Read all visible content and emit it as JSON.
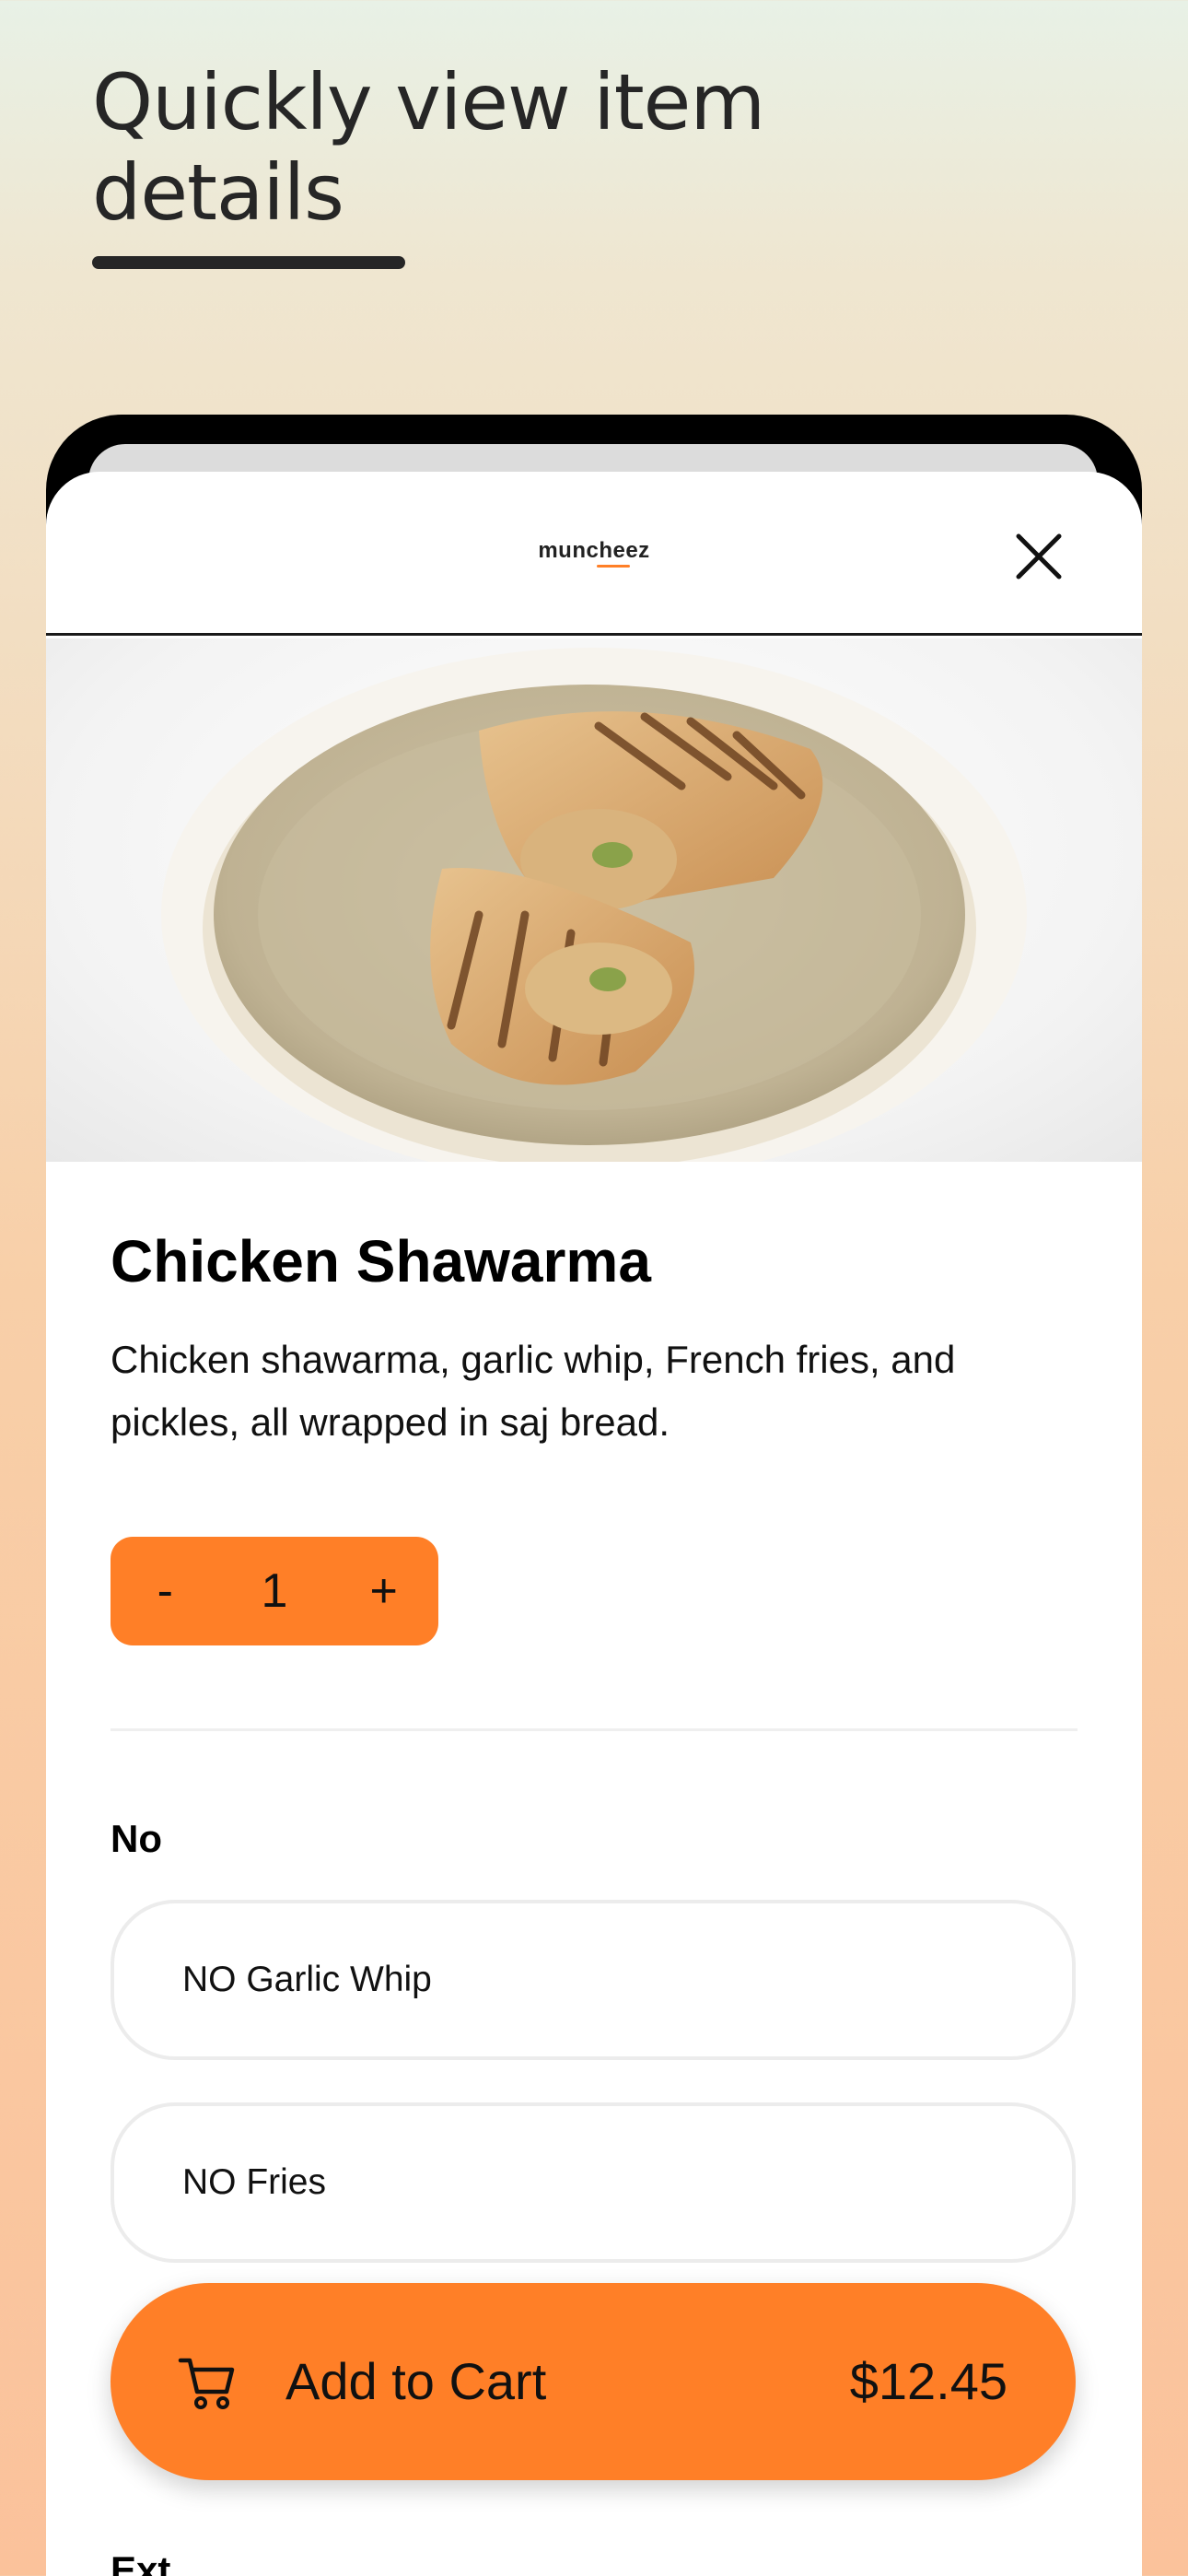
{
  "headline": {
    "line1": "Quickly view item",
    "line2": "details"
  },
  "header": {
    "logo_text": "muncheez",
    "close_icon": "close-icon"
  },
  "item": {
    "image_alt": "chicken-shawarma-photo",
    "title": "Chicken Shawarma",
    "description": "Chicken shawarma, garlic whip, French fries, and pickles, all wrapped in saj bread."
  },
  "quantity": {
    "decrement_label": "-",
    "value": "1",
    "increment_label": "+"
  },
  "option_groups": [
    {
      "title": "No",
      "options": [
        {
          "label": "NO Garlic Whip"
        },
        {
          "label": "NO Fries"
        }
      ]
    }
  ],
  "next_group_partial": "Ext",
  "cart": {
    "icon": "cart-icon",
    "label": "Add to Cart",
    "price": "$12.45"
  },
  "colors": {
    "accent": "#ff7f27",
    "text": "#111111",
    "headline": "#262626"
  }
}
